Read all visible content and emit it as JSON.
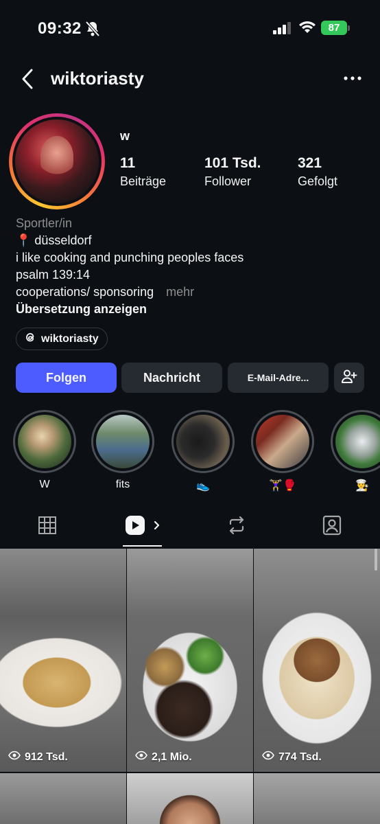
{
  "status_bar": {
    "time": "09:32",
    "battery": "87"
  },
  "header": {
    "username": "wiktoriasty"
  },
  "profile": {
    "display_name": "w",
    "stats": [
      {
        "value": "11",
        "label": "Beiträge"
      },
      {
        "value": "101 Tsd.",
        "label": "Follower"
      },
      {
        "value": "321",
        "label": "Gefolgt"
      }
    ],
    "category": "Sportler/in",
    "bio_lines": [
      "📍 düsseldorf",
      "i like cooking and punching peoples faces",
      "psalm 139:14",
      "cooperations/ sponsoring"
    ],
    "more_label": "mehr",
    "translate_label": "Übersetzung anzeigen",
    "threads_handle": "wiktoriasty"
  },
  "actions": {
    "follow_label": "Folgen",
    "message_label": "Nachricht",
    "email_label": "E-Mail-Adre..."
  },
  "highlights": [
    {
      "label": "W"
    },
    {
      "label": "fits"
    },
    {
      "label": "👟"
    },
    {
      "label": "🏋️‍♀️🥊"
    },
    {
      "label": "👨‍🍳"
    }
  ],
  "tabs": [
    "grid-icon",
    "reels-icon",
    "reposts-icon",
    "tagged-icon"
  ],
  "reels": [
    {
      "views": "912 Tsd."
    },
    {
      "views": "2,1 Mio."
    },
    {
      "views": "774 Tsd."
    }
  ],
  "colors": {
    "background": "#0c1014",
    "follow_button": "#4d5cff",
    "secondary_button": "#262a31",
    "battery": "#34c759"
  }
}
